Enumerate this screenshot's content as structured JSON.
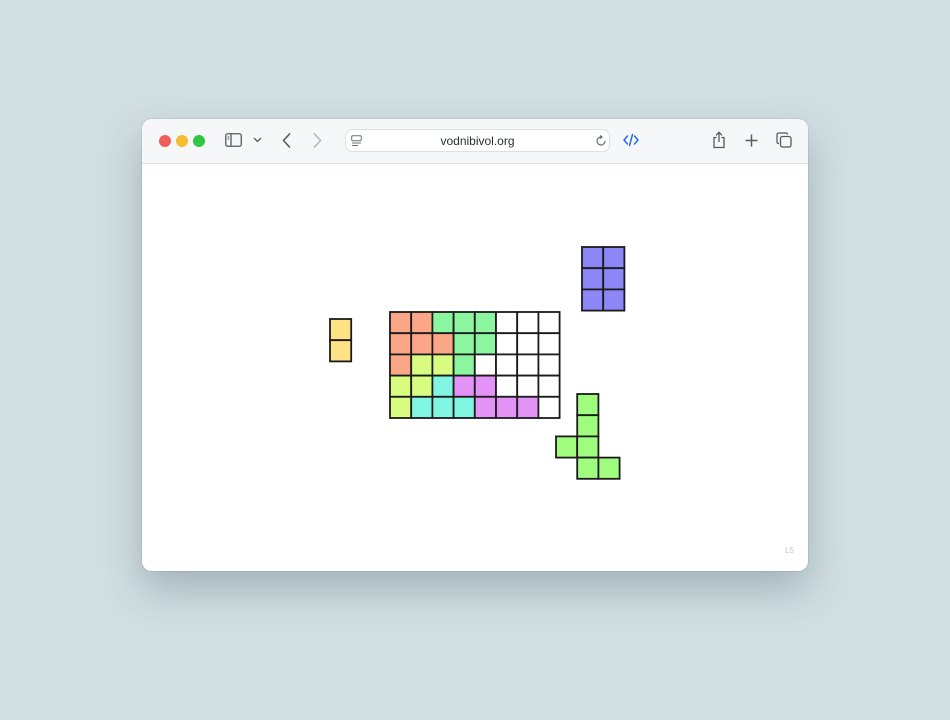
{
  "window": {
    "url": "vodnibivol.org"
  },
  "toolbar": {
    "traffic_lights": [
      {
        "name": "close",
        "color": "#ee5f57"
      },
      {
        "name": "minimize",
        "color": "#f6bd2e"
      },
      {
        "name": "zoom",
        "color": "#2ec842"
      }
    ]
  },
  "puzzle": {
    "level_label": "L5",
    "board": {
      "cols": 8,
      "rows": 5,
      "cells": [
        [
          "#fba687",
          "#fba687",
          "#8bf59f",
          "#8bf59f",
          "#8bf59f",
          "#ffffff",
          "#ffffff",
          "#ffffff"
        ],
        [
          "#fba687",
          "#fba687",
          "#fba687",
          "#8bf59f",
          "#8bf59f",
          "#ffffff",
          "#ffffff",
          "#ffffff"
        ],
        [
          "#fba687",
          "#d8fc7f",
          "#d8fc7f",
          "#8bf59f",
          "#ffffff",
          "#ffffff",
          "#ffffff",
          "#ffffff"
        ],
        [
          "#d8fc7f",
          "#d8fc7f",
          "#80f5e1",
          "#e293f5",
          "#e293f5",
          "#ffffff",
          "#ffffff",
          "#ffffff"
        ],
        [
          "#d8fc7f",
          "#80f5e1",
          "#80f5e1",
          "#80f5e1",
          "#e293f5",
          "#e293f5",
          "#e293f5",
          "#ffffff"
        ]
      ]
    },
    "loose_pieces": [
      {
        "name": "yellow-domino",
        "color": "#ffe286",
        "cells": [
          [
            0,
            0
          ],
          [
            0,
            1
          ]
        ]
      },
      {
        "name": "blue-rectangle",
        "color": "#8c87f7",
        "cells": [
          [
            0,
            0
          ],
          [
            1,
            0
          ],
          [
            0,
            1
          ],
          [
            1,
            1
          ],
          [
            0,
            2
          ],
          [
            1,
            2
          ]
        ]
      },
      {
        "name": "green-shape",
        "color": "#a0fc7f",
        "cells": [
          [
            1,
            0
          ],
          [
            1,
            1
          ],
          [
            0,
            2
          ],
          [
            1,
            2
          ],
          [
            1,
            3
          ],
          [
            2,
            3
          ]
        ]
      }
    ]
  }
}
